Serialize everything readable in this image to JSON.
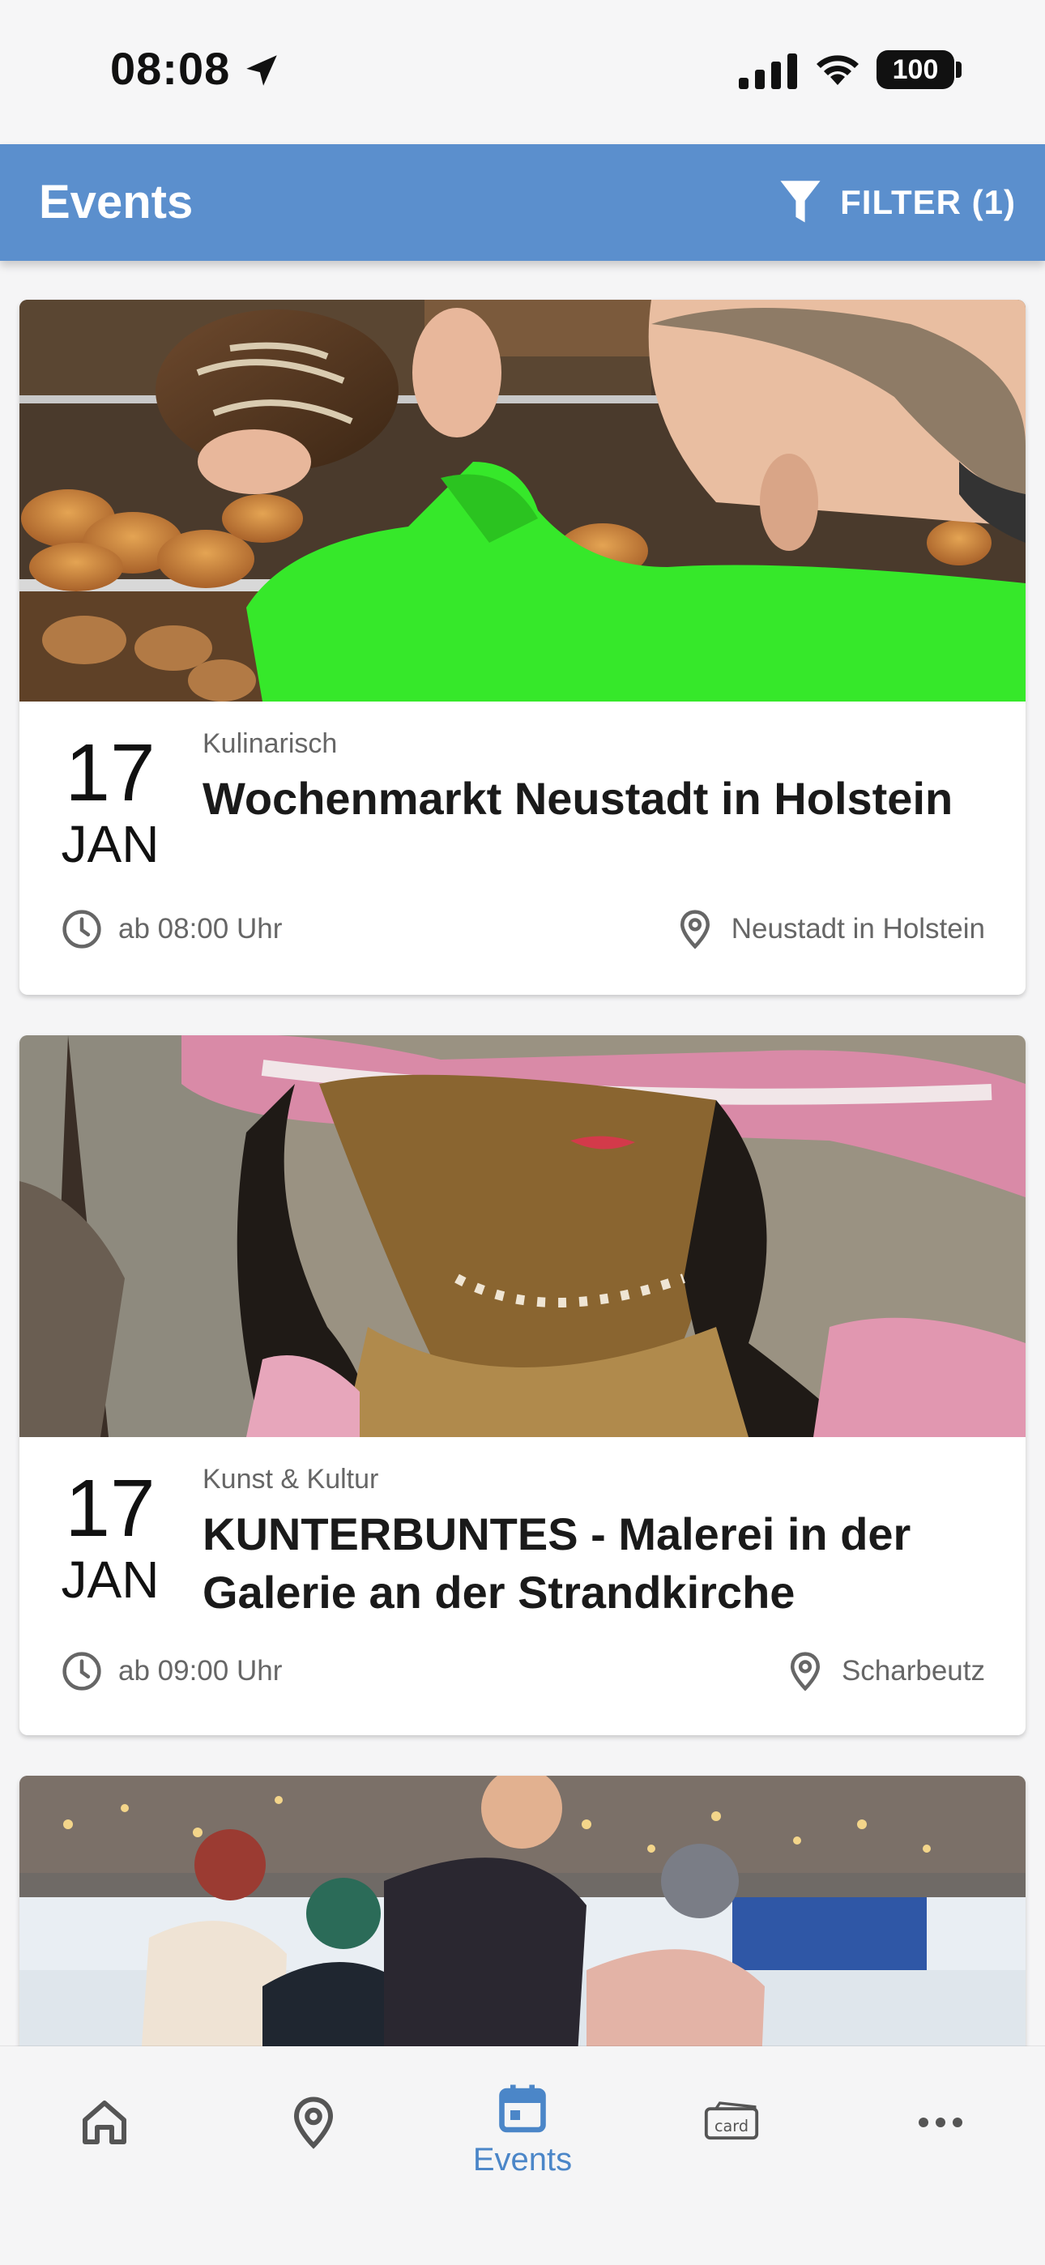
{
  "status_bar": {
    "time": "08:08",
    "battery": "100"
  },
  "app_bar": {
    "title": "Events",
    "filter_label": "FILTER (1)"
  },
  "events": [
    {
      "day": "17",
      "month": "JAN",
      "category": "Kulinarisch",
      "title": "Wochenmarkt Neustadt in Holstein",
      "time": "ab 08:00 Uhr",
      "location": "Neustadt in Holstein"
    },
    {
      "day": "17",
      "month": "JAN",
      "category": "Kunst & Kultur",
      "title": "KUNTERBUNTES - Malerei in der Galerie an der Strandkirche",
      "time": "ab 09:00 Uhr",
      "location": "Scharbeutz"
    }
  ],
  "bottom_nav": {
    "active": "events",
    "items": [
      {
        "id": "home",
        "icon": "home-icon"
      },
      {
        "id": "map",
        "icon": "map-pin-icon"
      },
      {
        "id": "events",
        "icon": "calendar-icon",
        "label": "Events"
      },
      {
        "id": "card",
        "icon": "card-icon",
        "icon_text": "card"
      },
      {
        "id": "more",
        "icon": "more-dots-icon"
      }
    ]
  },
  "colors": {
    "accent": "#5b8fcd",
    "nav_active": "#4b86c8",
    "nav_inactive": "#555555",
    "meta_text": "#666666"
  }
}
